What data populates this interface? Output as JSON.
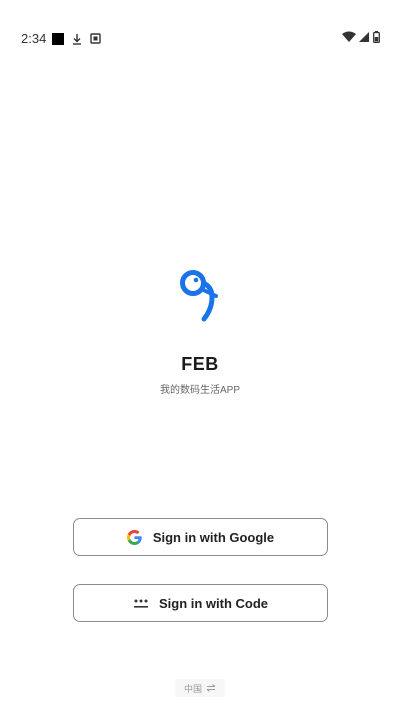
{
  "status_bar": {
    "time": "2:34",
    "left_icons": [
      "black-square-notification-icon",
      "download-icon",
      "app-notification-icon"
    ],
    "right_icons": [
      "wifi-icon",
      "cell-signal-icon",
      "battery-icon"
    ]
  },
  "app": {
    "logo_icon": "feb-logo-icon",
    "name": "FEB",
    "tagline": "我的数码生活APP",
    "brand_color": "#1a73e8"
  },
  "buttons": {
    "google": {
      "label": "Sign in with Google",
      "icon": "google-g-icon"
    },
    "code": {
      "label": "Sign in with Code",
      "icon": "code-dots-icon"
    }
  },
  "region_selector": {
    "label": "中国",
    "icon": "swap-arrows-icon"
  }
}
